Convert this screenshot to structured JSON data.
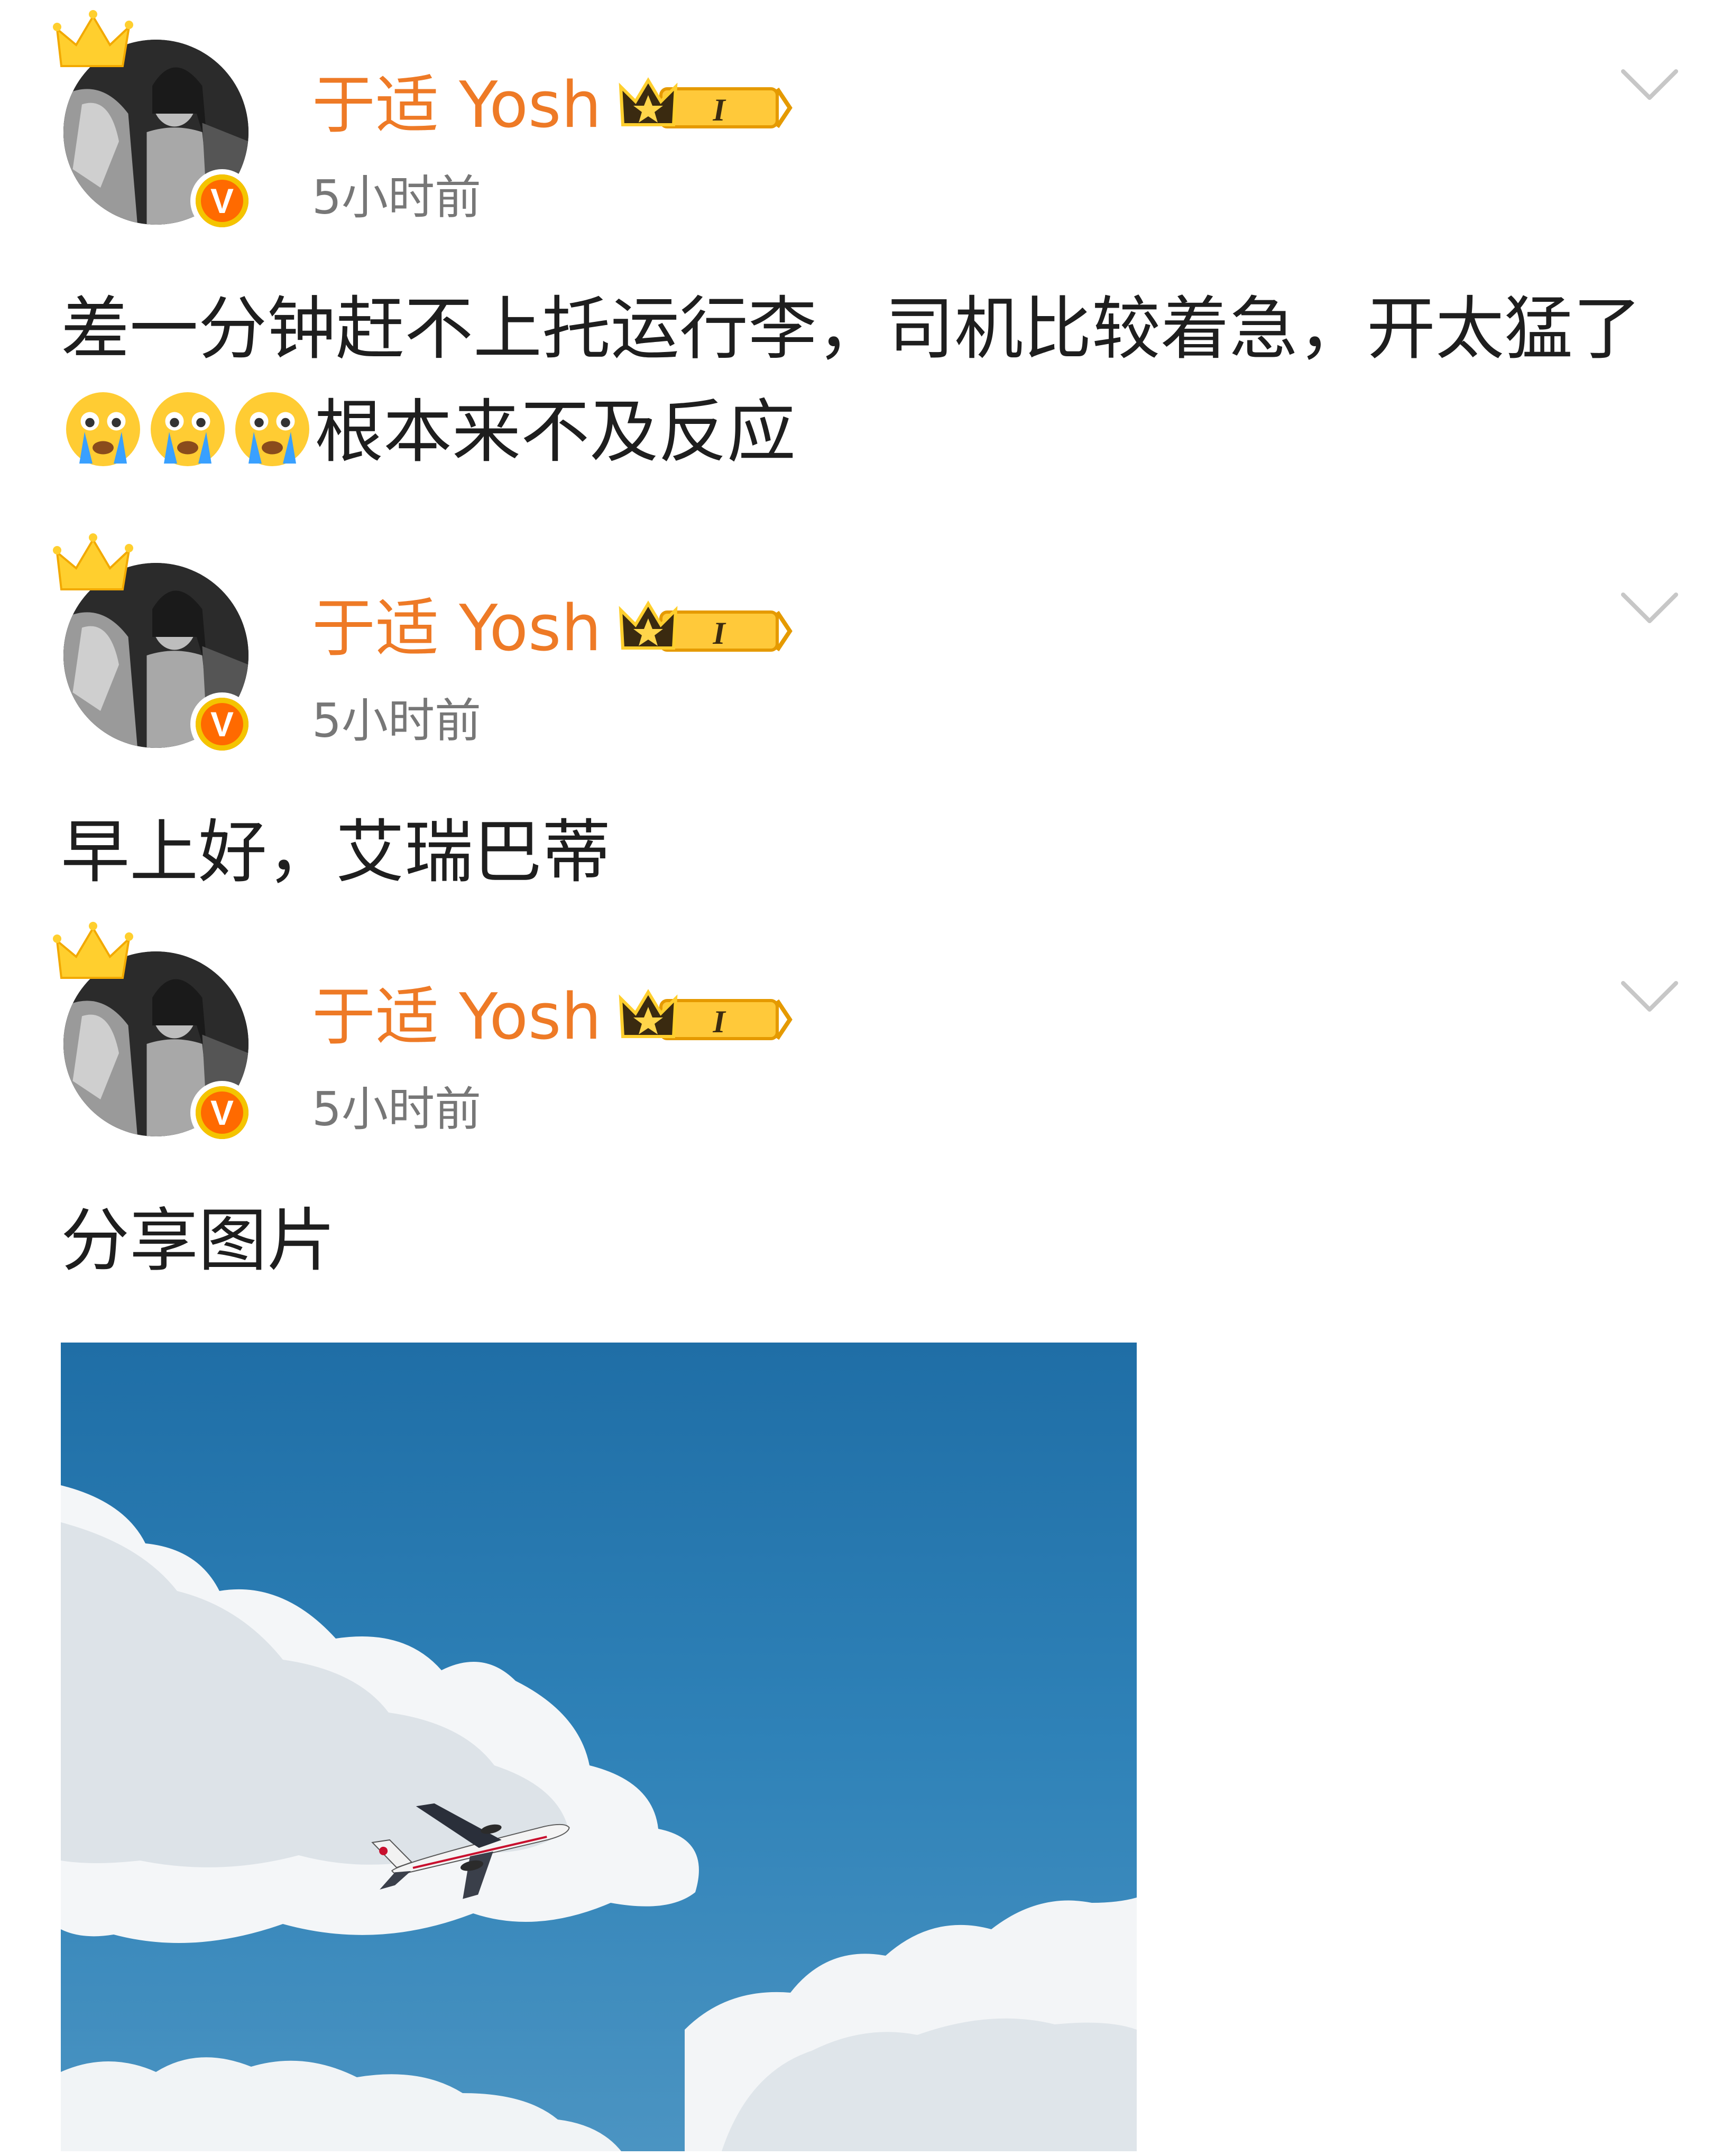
{
  "posts": [
    {
      "username": "于适 Yosh",
      "member_level": "I",
      "verified_mark": "V",
      "time": "5小时前",
      "text_parts": [
        "差一分钟赶不上托运行李，司机比较着急，开太猛了",
        "根本来不及反应"
      ],
      "emojis": [
        "crying-face-icon",
        "crying-face-icon",
        "crying-face-icon"
      ]
    },
    {
      "username": "于适 Yosh",
      "member_level": "I",
      "verified_mark": "V",
      "time": "5小时前",
      "text": "早上好，艾瑞巴蒂"
    },
    {
      "username": "于适 Yosh",
      "member_level": "I",
      "verified_mark": "V",
      "time": "5小时前",
      "text": "分享图片",
      "image": "airplane-in-blue-sky-photo"
    }
  ],
  "colors": {
    "username": "#ee7a26",
    "time": "#777777",
    "text": "#1e1e1e",
    "badge_orange": "#ff6a00",
    "badge_gold": "#f4c400",
    "sky": "#2a78ac"
  }
}
